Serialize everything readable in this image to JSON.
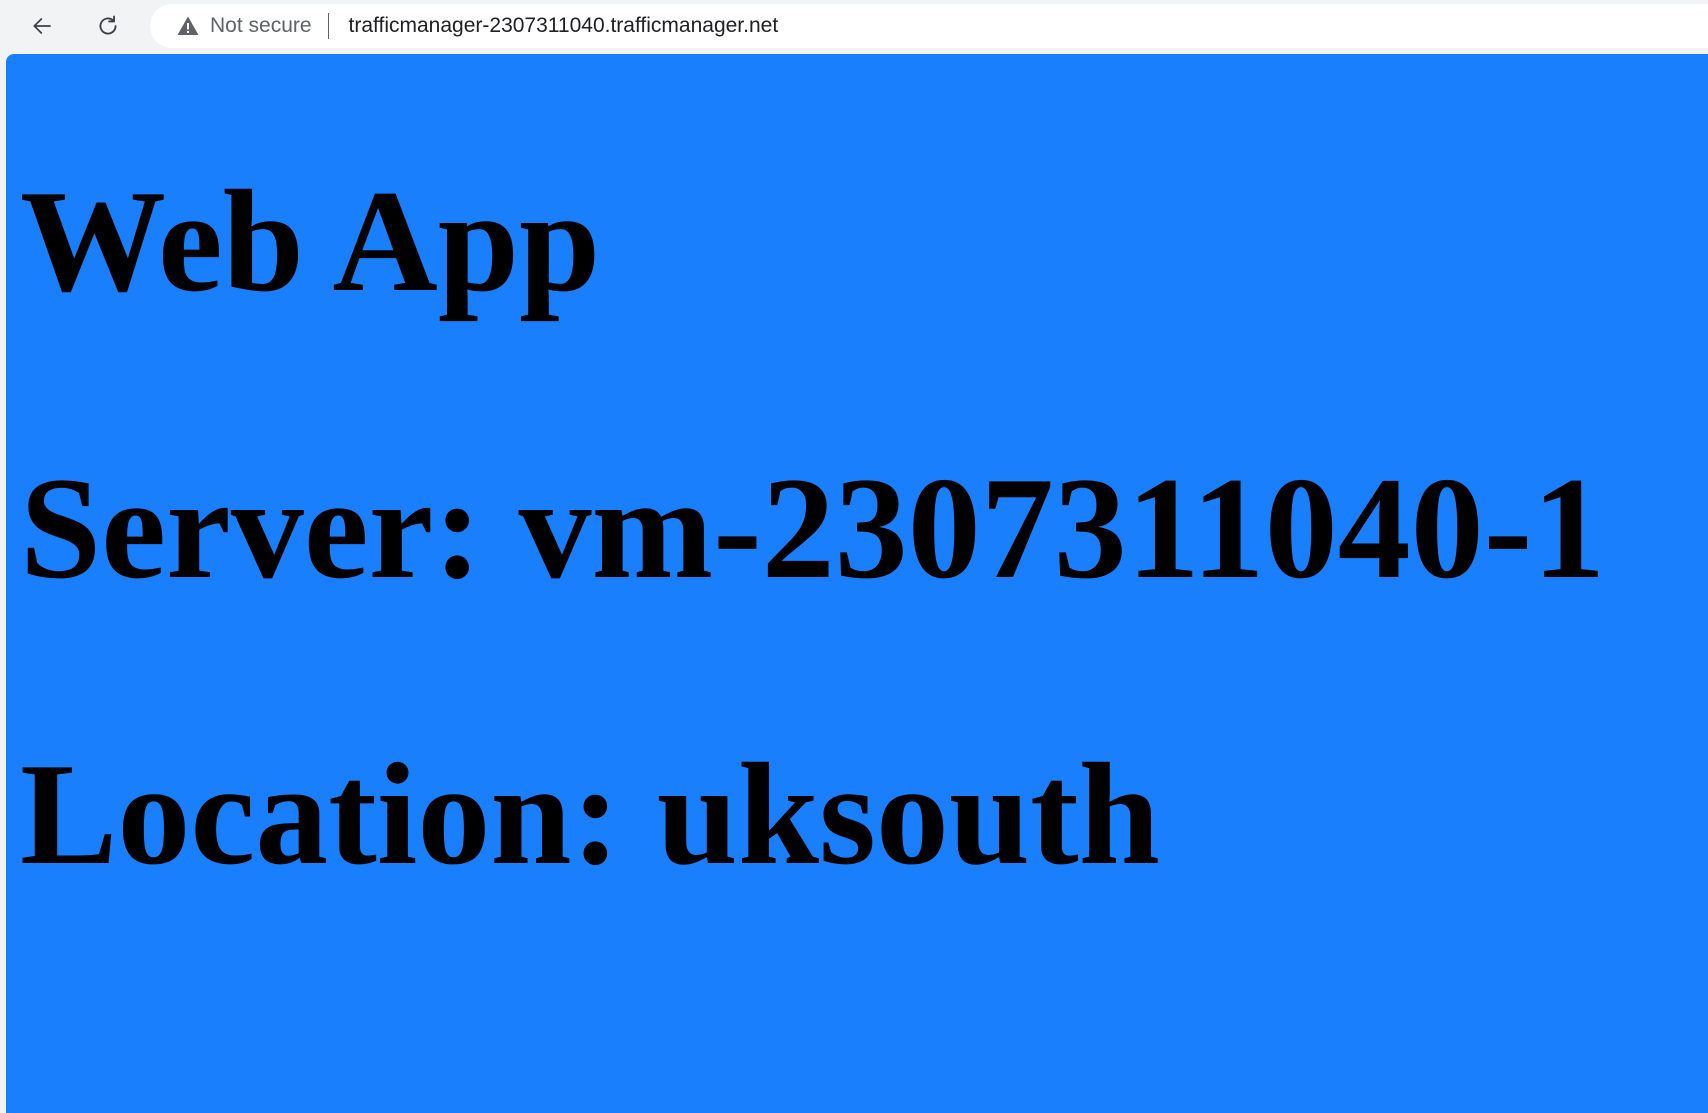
{
  "browser": {
    "back_icon": "arrow-left-icon",
    "reload_icon": "reload-icon",
    "security_icon": "warning-triangle-icon",
    "security_label": "Not secure",
    "url": "trafficmanager-2307311040.trafficmanager.net"
  },
  "page": {
    "background_color": "#1a7ffc",
    "title": "Web App",
    "server_line": "Server: vm-2307311040-1",
    "location_line": "Location: uksouth"
  }
}
